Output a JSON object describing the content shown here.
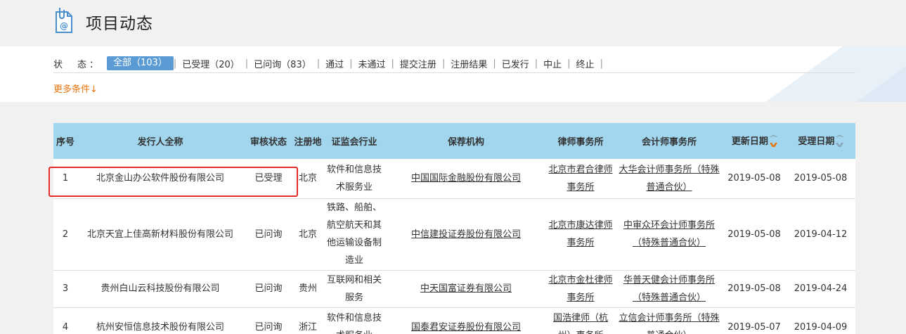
{
  "header": {
    "title": "项目动态",
    "icon": "document-email-icon"
  },
  "filters": {
    "label": "状　态：",
    "active": "全部（103）",
    "items": [
      "已受理（20）",
      "已问询（83）",
      "通过",
      "未通过",
      "提交注册",
      "注册结果",
      "已发行",
      "中止",
      "终止"
    ],
    "more": "更多条件↓"
  },
  "table": {
    "headers": {
      "no": "序号",
      "issuer": "发行人全称",
      "status": "审核状态",
      "region": "注册地",
      "industry": "证监会行业",
      "sponsor": "保荐机构",
      "law": "律师事务所",
      "accounting": "会计师事务所",
      "updated": "更新日期",
      "accepted": "受理日期"
    },
    "rows": [
      {
        "no": "1",
        "issuer": "北京金山办公软件股份有限公司",
        "status": "已受理",
        "region": "北京",
        "industry": "软件和信息技术服务业",
        "sponsor": "中国国际金融股份有限公司",
        "law": "北京市君合律师事务所",
        "accounting": "大华会计师事务所（特殊普通合伙）",
        "updated": "2019-05-08",
        "accepted": "2019-05-08"
      },
      {
        "no": "2",
        "issuer": "北京天宜上佳高新材料股份有限公司",
        "status": "已问询",
        "region": "北京",
        "industry": "铁路、船舶、航空航天和其他运输设备制造业",
        "sponsor": "中信建投证券股份有限公司",
        "law": "北京市康达律师事务所",
        "accounting": "中审众环会计师事务所（特殊普通合伙）",
        "updated": "2019-05-08",
        "accepted": "2019-04-12"
      },
      {
        "no": "3",
        "issuer": "贵州白山云科技股份有限公司",
        "status": "已问询",
        "region": "贵州",
        "industry": "互联网和相关服务",
        "sponsor": "中天国富证券有限公司",
        "law": "北京市金杜律师事务所",
        "accounting": "华普天健会计师事务所（特殊普通合伙）",
        "updated": "2019-05-08",
        "accepted": "2019-04-24"
      },
      {
        "no": "4",
        "issuer": "杭州安恒信息技术股份有限公司",
        "status": "已问询",
        "region": "浙江",
        "industry": "软件和信息技术服务业",
        "sponsor": "国泰君安证券股份有限公司",
        "law": "国浩律师（杭州）事务所",
        "accounting": "立信会计师事务所（特殊普通合伙）",
        "updated": "2019-05-07",
        "accepted": "2019-04-09"
      }
    ]
  },
  "colors": {
    "accent": "#5b9bd5",
    "header_bg": "#a2d6ef",
    "more": "#e8740c",
    "highlight": "#e52a2a"
  }
}
